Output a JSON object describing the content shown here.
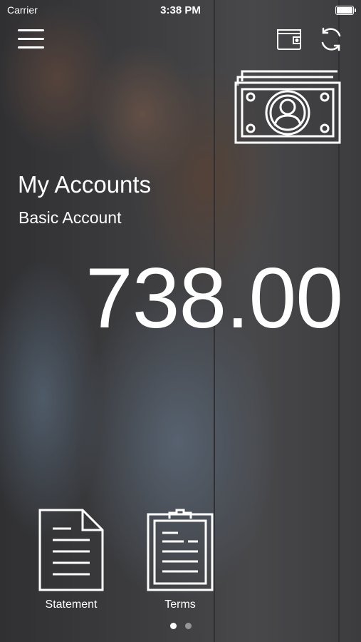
{
  "status_bar": {
    "carrier": "Carrier",
    "time": "3:38 PM"
  },
  "header": {
    "icons": [
      "menu-icon",
      "wallet-icon",
      "refresh-icon"
    ]
  },
  "hero": {
    "icon": "money-icon"
  },
  "account": {
    "title": "My Accounts",
    "type": "Basic Account",
    "balance": "738.00"
  },
  "actions": [
    {
      "label": "Statement",
      "icon": "document-icon"
    },
    {
      "label": "Terms",
      "icon": "clipboard-icon"
    }
  ],
  "pager": {
    "page_count": 2,
    "current_page": 1
  }
}
